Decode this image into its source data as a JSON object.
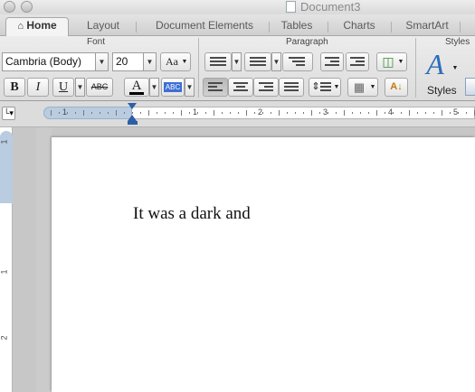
{
  "window": {
    "title": "Document3"
  },
  "tabs": [
    {
      "label": "Home",
      "active": true,
      "icon": "home-icon"
    },
    {
      "label": "Layout"
    },
    {
      "label": "Document Elements"
    },
    {
      "label": "Tables"
    },
    {
      "label": "Charts"
    },
    {
      "label": "SmartArt"
    }
  ],
  "ribbon": {
    "font_group_label": "Font",
    "paragraph_group_label": "Paragraph",
    "styles_group_label": "Styles",
    "font_name": "Cambria (Body)",
    "font_size": "20",
    "change_case_label": "Aa",
    "bold_label": "B",
    "italic_label": "I",
    "underline_label": "U",
    "strike_label": "ABC",
    "font_color_label": "A",
    "highlight_label": "ABC",
    "styles_label": "Styles",
    "font_color": "#000000",
    "highlight_color": "#3d6fd4"
  },
  "ruler": {
    "marks": [
      "1",
      "1",
      "2",
      "3",
      "4",
      "5"
    ]
  },
  "vruler": {
    "marks": [
      "1",
      "1",
      "2"
    ]
  },
  "document": {
    "text": "It was a dark and"
  }
}
